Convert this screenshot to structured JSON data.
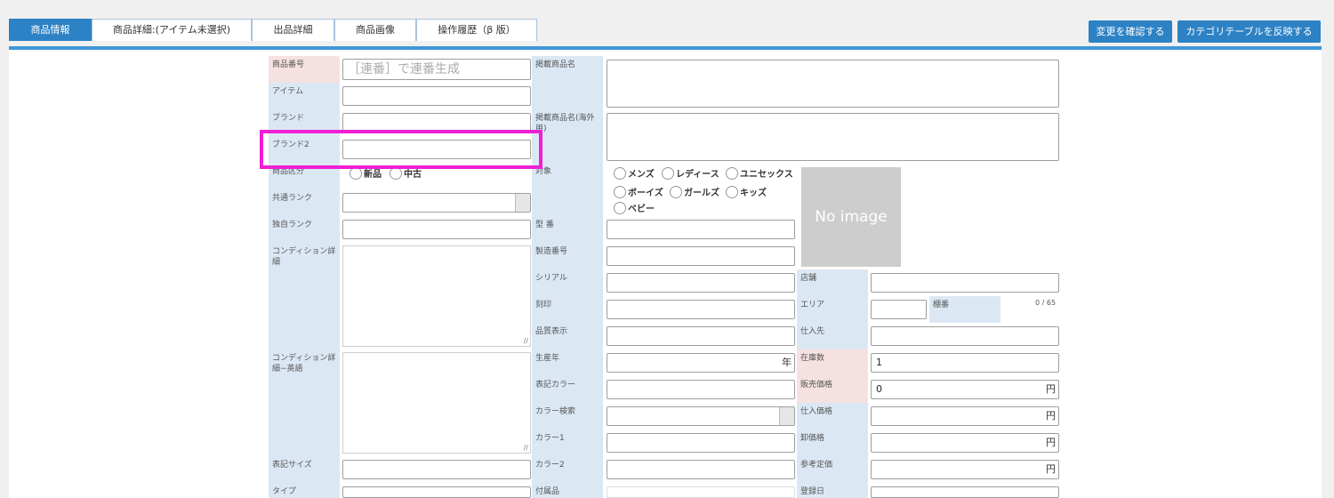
{
  "tabs": [
    {
      "label": "商品情報",
      "active": true
    },
    {
      "label": "商品詳細:(アイテム未選択)",
      "active": false
    },
    {
      "label": "出品詳細",
      "active": false
    },
    {
      "label": "商品画像",
      "active": false
    },
    {
      "label": "操作履歴（β 版）",
      "active": false
    }
  ],
  "actions": {
    "confirm_changes": "変更を確認する",
    "apply_category_table": "カテゴリテーブルを反映する"
  },
  "col1": {
    "product_number": "商品番号",
    "product_number_placeholder": "［連番］で連番生成",
    "item": "アイテム",
    "brand": "ブランド",
    "brand2": "ブランド2",
    "product_type": "商品区分",
    "product_type_options": [
      "新品",
      "中古"
    ],
    "common_rank": "共通ランク",
    "own_rank": "独自ランク",
    "condition_detail": "コンディション詳細",
    "condition_detail_en": "コンディション詳細−英語",
    "display_size": "表記サイズ",
    "type": "タイプ"
  },
  "col2": {
    "listing_name": "掲載商品名",
    "listing_name_overseas": "掲載商品名(海外用)",
    "target": "対象",
    "target_options": [
      "メンズ",
      "レディース",
      "ユニセックス",
      "ボーイズ",
      "ガールズ",
      "キッズ",
      "ベビー"
    ],
    "model_number": "型 番",
    "serial_number_mfg": "製造番号",
    "serial": "シリアル",
    "engraving": "刻印",
    "quality_label": "品質表示",
    "production_year": "生産年",
    "year_unit": "年",
    "display_color": "表記カラー",
    "color_search": "カラー検索",
    "color1": "カラー1",
    "color2": "カラー2",
    "accessories": "付属品"
  },
  "col3": {
    "no_image": "No image",
    "store": "店舗",
    "area": "エリア",
    "shelf": "棚番",
    "shelf_counter": "0 / 65",
    "supplier": "仕入先",
    "stock_qty": "在庫数",
    "stock_qty_value": "1",
    "sale_price": "販売価格",
    "sale_price_value": "0",
    "purchase_price": "仕入価格",
    "wholesale_price": "卸価格",
    "reference_price": "参考定価",
    "registration_date": "登録日",
    "yen": "円"
  },
  "colors": {
    "accent": "#2c82c5",
    "highlight": "#ee1fd6",
    "label_bg": "#dbe8f4",
    "label_required_bg": "#f6e1e1"
  }
}
